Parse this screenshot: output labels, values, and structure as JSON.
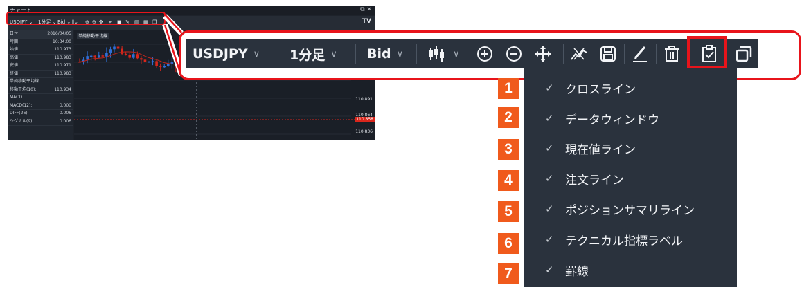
{
  "window": {
    "title": "チャート",
    "controls": "⧉ ✕"
  },
  "mini_toolbar": {
    "symbol": "USDJPY",
    "timeframe": "1分足",
    "price_type": "Bid",
    "logo": "TV"
  },
  "data_window": {
    "rows": [
      {
        "label": "日付",
        "value": "2016/04/05"
      },
      {
        "label": "時間",
        "value": "10:34:00"
      },
      {
        "label": "始値",
        "value": "110.973"
      },
      {
        "label": "高値",
        "value": "110.983"
      },
      {
        "label": "安値",
        "value": "110.971"
      },
      {
        "label": "終値",
        "value": "110.983"
      },
      {
        "label": "単純移動平均線",
        "value": ""
      },
      {
        "label": "移動平均(10):",
        "value": "110.934"
      },
      {
        "label": "MACD",
        "value": ""
      },
      {
        "label": "MACD(12):",
        "value": "0.000"
      },
      {
        "label": "DIFF(26):",
        "value": "-0.006"
      },
      {
        "label": "シグナル(9):",
        "value": "0.006"
      }
    ]
  },
  "plot": {
    "indicator_label": "単純移動平均線",
    "price_labels": [
      "110.891",
      "110.864",
      "110.858",
      "110.836"
    ]
  },
  "toolbar": {
    "symbol": "USDJPY",
    "timeframe": "1分足",
    "price_type": "Bid",
    "icons": [
      "candlestick-icon",
      "zoom-in-icon",
      "zoom-out-icon",
      "move-icon",
      "crosshair-icon",
      "save-icon",
      "pencil-icon",
      "trash-icon",
      "clipboard-check-icon",
      "copy-icon"
    ]
  },
  "menu": {
    "items": [
      {
        "number": "1",
        "label": "クロスライン"
      },
      {
        "number": "2",
        "label": "データウィンドウ"
      },
      {
        "number": "3",
        "label": "現在値ライン"
      },
      {
        "number": "4",
        "label": "注文ライン"
      },
      {
        "number": "5",
        "label": "ポジションサマリライン"
      },
      {
        "number": "6",
        "label": "テクニカル指標ラベル"
      },
      {
        "number": "7",
        "label": "罫線"
      }
    ]
  },
  "colors": {
    "highlight": "#e8141b",
    "badge": "#f05a1c",
    "toolbar_bg": "#2a323d",
    "bull_candle": "#2f6fd8",
    "bear_candle": "#d9261c"
  }
}
